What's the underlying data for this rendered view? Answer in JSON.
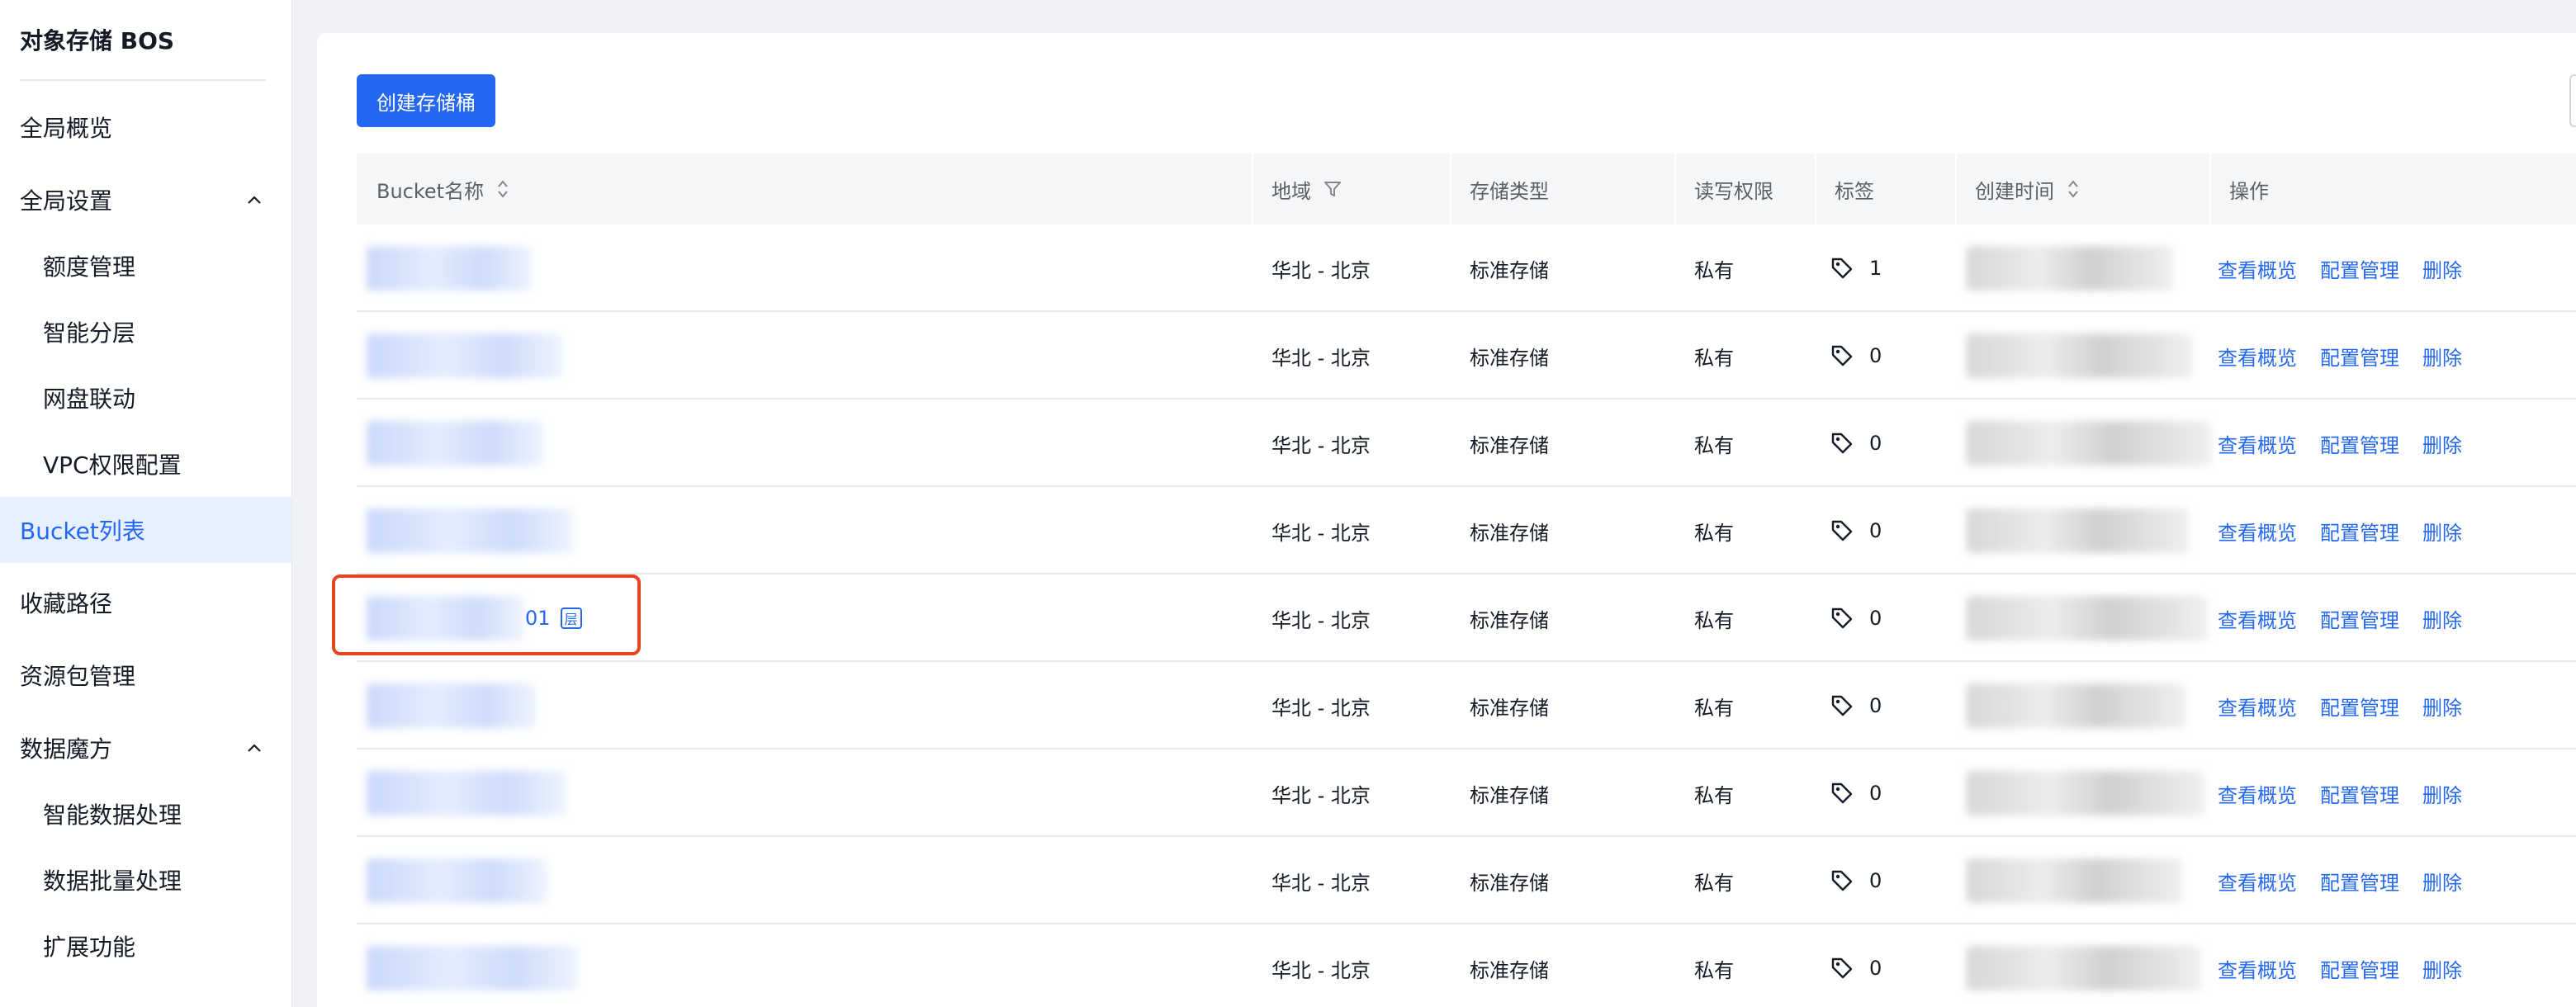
{
  "sidebar": {
    "brand": "对象存储 BOS",
    "items": [
      {
        "label": "全局概览"
      },
      {
        "label": "全局设置"
      },
      {
        "label": "额度管理"
      },
      {
        "label": "智能分层"
      },
      {
        "label": "网盘联动"
      },
      {
        "label": "VPC权限配置"
      },
      {
        "label": "Bucket列表"
      },
      {
        "label": "收藏路径"
      },
      {
        "label": "资源包管理"
      },
      {
        "label": "数据魔方"
      },
      {
        "label": "智能数据处理"
      },
      {
        "label": "数据批量处理"
      },
      {
        "label": "扩展功能"
      }
    ]
  },
  "toolbar": {
    "create_label": "创建存储桶"
  },
  "table": {
    "headers": {
      "name": "Bucket名称",
      "region": "地域",
      "storage": "存储类型",
      "acl": "读写权限",
      "tags": "标签",
      "created": "创建时间",
      "ops": "操作"
    },
    "op_labels": {
      "overview": "查看概览",
      "config": "配置管理",
      "delete": "删除"
    },
    "highlighted": {
      "suffix": "01",
      "badge": "层"
    },
    "rows": [
      {
        "region": "华北 - 北京",
        "storage": "标准存储",
        "acl": "私有",
        "tags": "1"
      },
      {
        "region": "华北 - 北京",
        "storage": "标准存储",
        "acl": "私有",
        "tags": "0"
      },
      {
        "region": "华北 - 北京",
        "storage": "标准存储",
        "acl": "私有",
        "tags": "0"
      },
      {
        "region": "华北 - 北京",
        "storage": "标准存储",
        "acl": "私有",
        "tags": "0"
      },
      {
        "region": "华北 - 北京",
        "storage": "标准存储",
        "acl": "私有",
        "tags": "0"
      },
      {
        "region": "华北 - 北京",
        "storage": "标准存储",
        "acl": "私有",
        "tags": "0"
      },
      {
        "region": "华北 - 北京",
        "storage": "标准存储",
        "acl": "私有",
        "tags": "0"
      },
      {
        "region": "华北 - 北京",
        "storage": "标准存储",
        "acl": "私有",
        "tags": "0"
      },
      {
        "region": "华北 - 北京",
        "storage": "标准存储",
        "acl": "私有",
        "tags": "0"
      }
    ]
  },
  "colors": {
    "accent": "#2468f2",
    "highlight_border": "#e8421f",
    "active_bg": "#e6f0ff"
  }
}
